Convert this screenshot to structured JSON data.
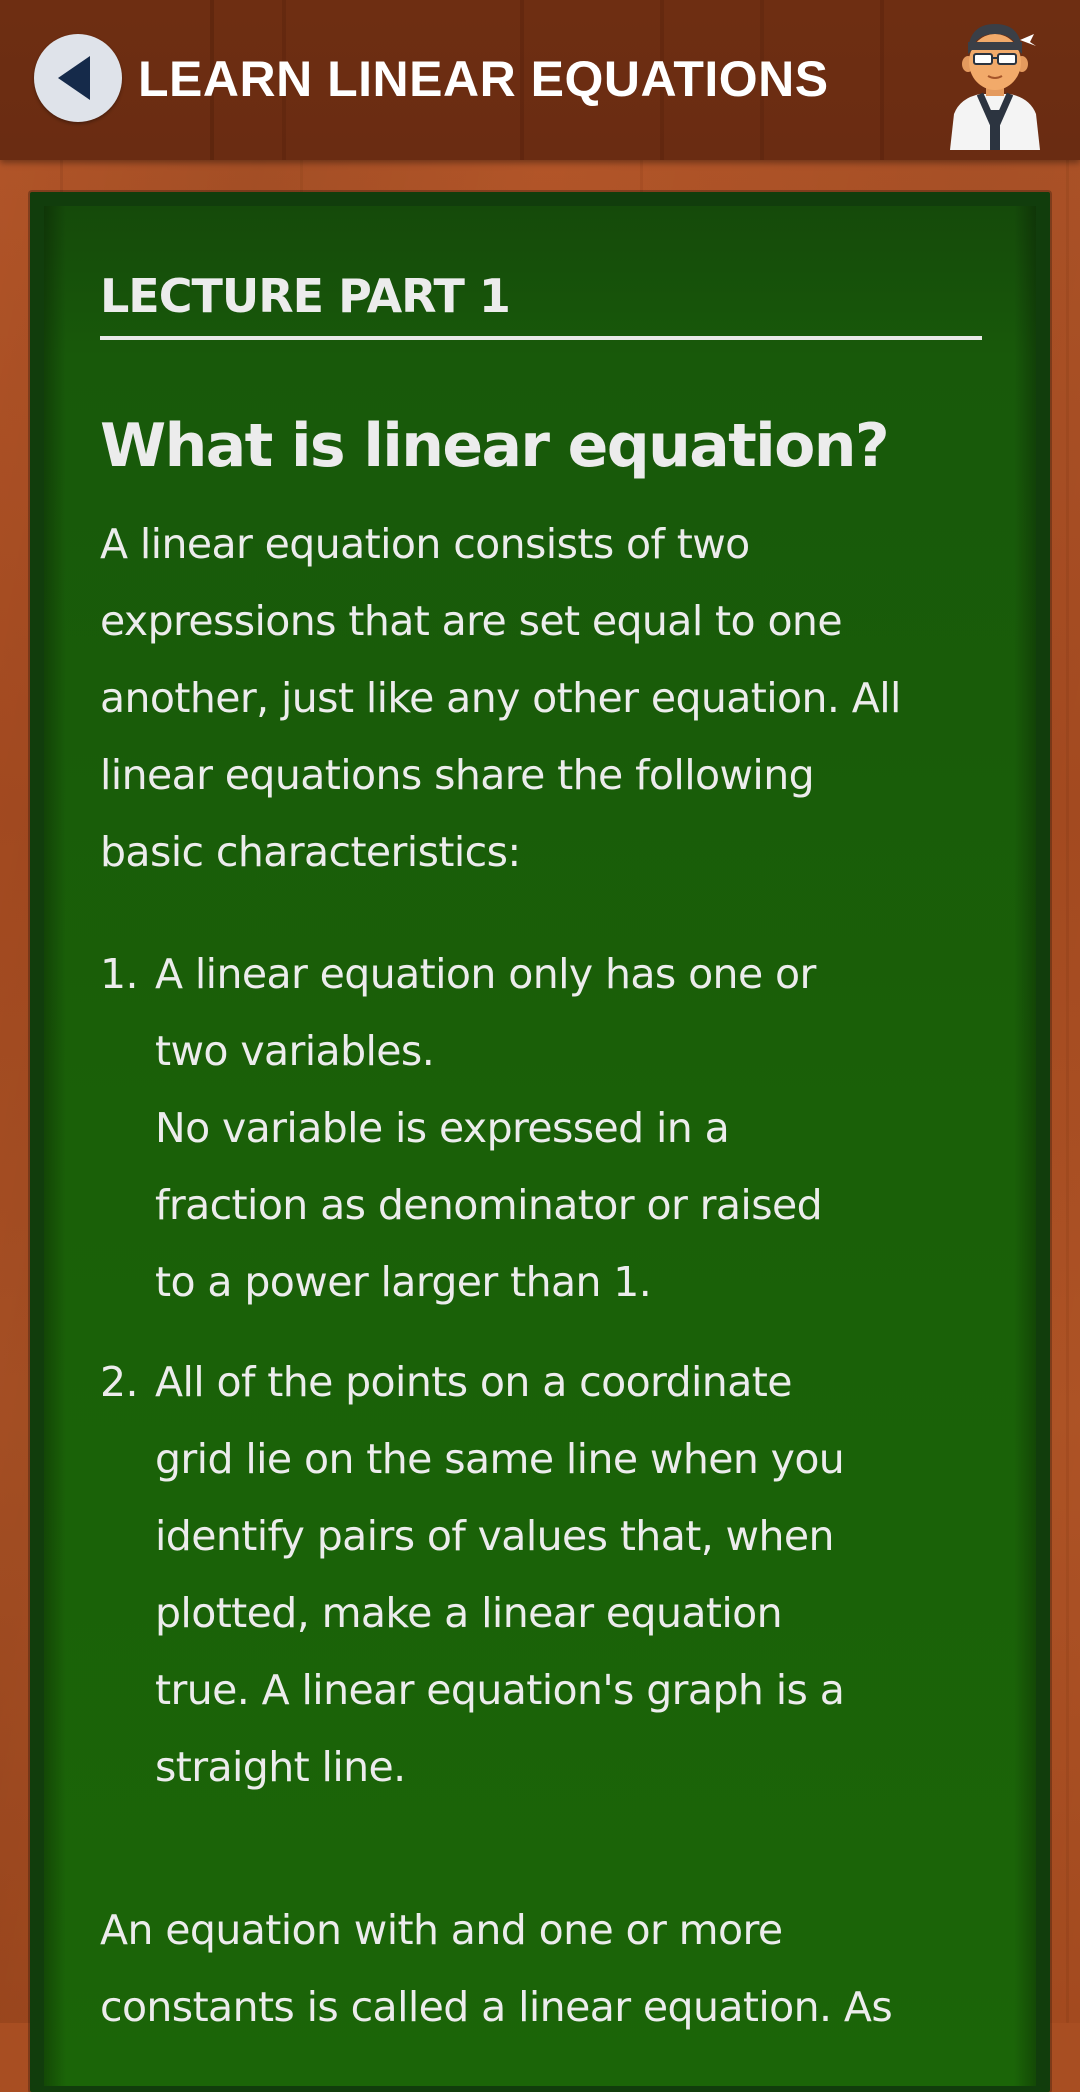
{
  "header": {
    "back_icon": "back-arrow-icon",
    "title": "LEARN LINEAR EQUATIONS",
    "avatar_icon": "teacher-avatar-icon"
  },
  "lecture": {
    "part_label": "LECTURE PART 1",
    "question": "What is linear equation?",
    "intro_lines": [
      "A linear equation consists of two",
      "expressions that are set equal to one",
      "another, just like any other equation. All",
      "linear equations share the following",
      "basic characteristics:"
    ],
    "items": [
      {
        "number": "1.",
        "lines": [
          "A linear equation only has one or",
          "two variables.",
          "No variable is expressed in a",
          "fraction as denominator or raised",
          "to a power larger than 1."
        ]
      },
      {
        "number": "2.",
        "lines": [
          "All of the points on a coordinate",
          "grid lie on the same line when you",
          "identify pairs of values that, when",
          "plotted, make a linear equation",
          "true. A linear equation's graph is a",
          "straight line."
        ]
      }
    ],
    "outro_lines": [
      "An equation with and one or more",
      "constants is called a linear equation. As"
    ]
  },
  "colors": {
    "header_bg": "#6e2e12",
    "wood_bg": "#a84e22",
    "board_green": "#1a6008",
    "chalk_text": "#ececec",
    "back_button_bg": "#dfe3ea",
    "back_arrow": "#152a4a"
  }
}
